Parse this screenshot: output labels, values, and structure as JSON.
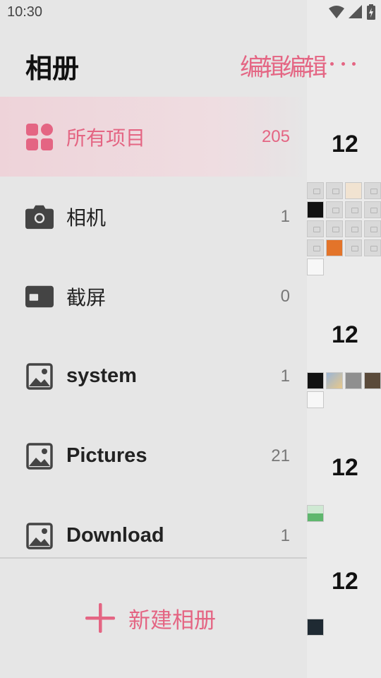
{
  "status_bar": {
    "time": "10:30"
  },
  "drawer": {
    "title": "相册",
    "albums": [
      {
        "name": "所有项目",
        "count": "205",
        "icon": "grid-icon",
        "selected": true
      },
      {
        "name": "相机",
        "count": "1",
        "icon": "camera-icon"
      },
      {
        "name": "截屏",
        "count": "0",
        "icon": "screenshot-icon"
      },
      {
        "name": "system",
        "count": "1",
        "icon": "image-icon"
      },
      {
        "name": "Pictures",
        "count": "21",
        "icon": "image-icon"
      },
      {
        "name": "Download",
        "count": "1",
        "icon": "image-icon"
      }
    ],
    "new_album_label": "新建相册"
  },
  "background": {
    "edit_label": "编辑编辑",
    "more_icon": "more-horizontal-icon",
    "date_headers": [
      "12",
      "12",
      "12",
      "12"
    ]
  },
  "colors": {
    "accent": "#e46583",
    "drawer_bg": "#e6e6e6",
    "selected_bg": "#eed3d9"
  }
}
